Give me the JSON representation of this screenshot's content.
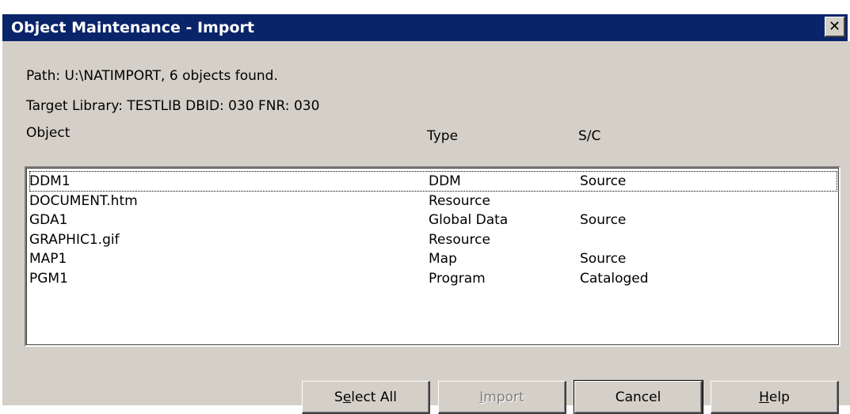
{
  "window": {
    "title": "Object Maintenance - Import",
    "close_glyph": "✕"
  },
  "info": {
    "path_line": "Path: U:\\NATIMPORT, 6 objects found.",
    "target_line": "Target Library: TESTLIB  DBID: 030  FNR: 030"
  },
  "columns": {
    "object": "Object",
    "type": "Type",
    "sc": "S/C"
  },
  "rows": [
    {
      "object": "DDM1",
      "type": "DDM",
      "sc": "Source",
      "focused": true
    },
    {
      "object": "DOCUMENT.htm",
      "type": "Resource",
      "sc": ""
    },
    {
      "object": "GDA1",
      "type": "Global Data",
      "sc": "Source"
    },
    {
      "object": "GRAPHIC1.gif",
      "type": "Resource",
      "sc": ""
    },
    {
      "object": "MAP1",
      "type": "Map",
      "sc": "Source"
    },
    {
      "object": "PGM1",
      "type": "Program",
      "sc": "Cataloged"
    }
  ],
  "buttons": {
    "select_all": {
      "pre": "S",
      "accel": "e",
      "post": "lect All"
    },
    "import": {
      "pre": "",
      "accel": "I",
      "post": "mport",
      "disabled": true
    },
    "cancel": {
      "pre": "Cancel",
      "accel": "",
      "post": ""
    },
    "help": {
      "pre": "",
      "accel": "H",
      "post": "elp"
    }
  },
  "colors": {
    "titlebar": "#0a246a",
    "face": "#d4d0c8",
    "disabled_text": "#808080"
  }
}
